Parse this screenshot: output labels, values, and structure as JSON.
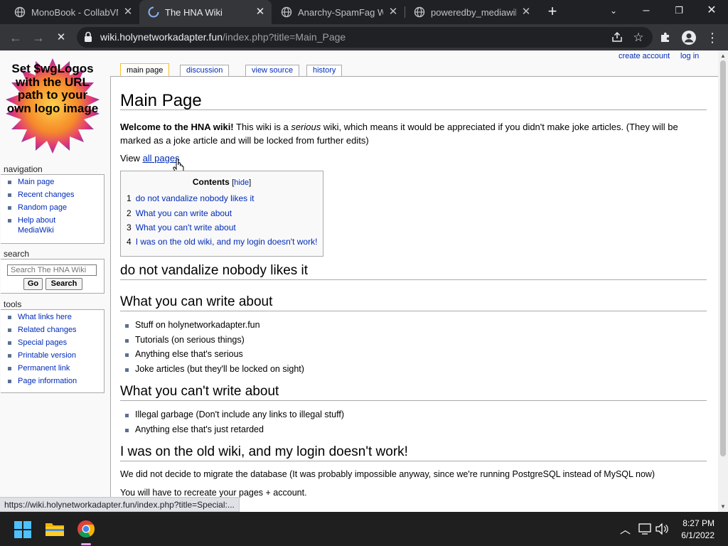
{
  "browser": {
    "tabs": [
      {
        "title": "MonoBook - CollabVM",
        "active": false
      },
      {
        "title": "The HNA Wiki",
        "active": true
      },
      {
        "title": "Anarchy-SpamFag Wiki",
        "active": false
      },
      {
        "title": "poweredby_mediawiki",
        "active": false
      }
    ],
    "url_host": "wiki.holynetworkadapter.fun",
    "url_path": "/index.php?title=Main_Page"
  },
  "wiki": {
    "logo_text": "Set $wgLogos with the URL path to your own logo image",
    "personal_tools": {
      "create_account": "create account",
      "log_in": "log in"
    },
    "content_tabs": {
      "main_page": "main page",
      "discussion": "discussion",
      "view_source": "view source",
      "history": "history"
    },
    "navigation": {
      "heading": "navigation",
      "items": [
        "Main page",
        "Recent changes",
        "Random page",
        "Help about MediaWiki"
      ]
    },
    "search": {
      "heading": "search",
      "placeholder": "Search The HNA Wiki",
      "go": "Go",
      "search": "Search"
    },
    "tools": {
      "heading": "tools",
      "items": [
        "What links here",
        "Related changes",
        "Special pages",
        "Printable version",
        "Permanent link",
        "Page information"
      ]
    },
    "page": {
      "title": "Main Page",
      "intro_bold": "Welcome to the HNA wiki!",
      "intro_1": " This wiki is a ",
      "intro_em": "serious",
      "intro_2": " wiki, which means it would be appreciated if you didn't make joke articles. (They will be marked as a joke article and will be locked from further edits)",
      "view_prefix": "View ",
      "view_link": "all pages",
      "toc": {
        "title": "Contents",
        "hide": "hide",
        "items": [
          {
            "num": "1",
            "text": "do not vandalize nobody likes it"
          },
          {
            "num": "2",
            "text": "What you can write about"
          },
          {
            "num": "3",
            "text": "What you can't write about"
          },
          {
            "num": "4",
            "text": "I was on the old wiki, and my login doesn't work!"
          }
        ]
      },
      "section1_title": "do not vandalize nobody likes it",
      "section2_title": "What you can write about",
      "section2_items": [
        "Stuff on holynetworkadapter.fun",
        "Tutorials (on serious things)",
        "Anything else that's serious",
        "Joke articles (but they'll be locked on sight)"
      ],
      "section3_title": "What you can't write about",
      "section3_items": [
        "Illegal garbage (Don't include any links to illegal stuff)",
        "Anything else that's just retarded"
      ],
      "section4_title": "I was on the old wiki, and my login doesn't work!",
      "section4_p1": "We did not decide to migrate the database (It was probably impossible anyway, since we're running PostgreSQL instead of MySQL now)",
      "section4_p2": "You will have to recreate your pages + account."
    },
    "status_url": "https://wiki.holynetworkadapter.fun/index.php?title=Special:..."
  },
  "taskbar": {
    "time": "8:27 PM",
    "date": "6/1/2022"
  }
}
